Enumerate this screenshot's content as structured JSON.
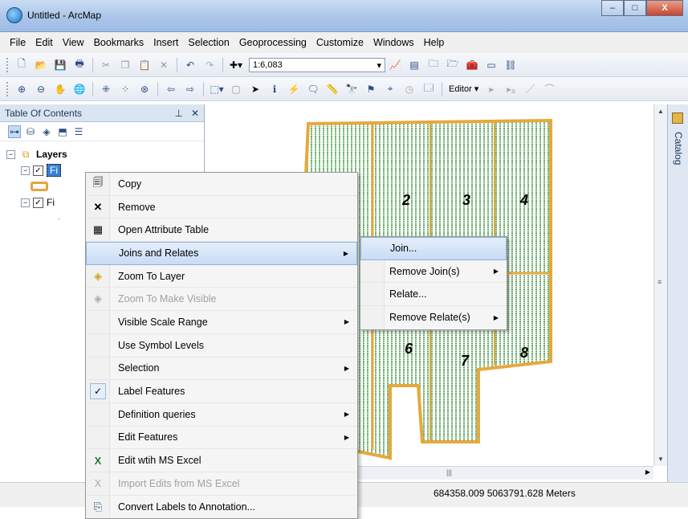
{
  "window": {
    "title": "Untitled - ArcMap",
    "minimize": "–",
    "maximize": "□",
    "close": "X"
  },
  "menubar": [
    "File",
    "Edit",
    "View",
    "Bookmarks",
    "Insert",
    "Selection",
    "Geoprocessing",
    "Customize",
    "Windows",
    "Help"
  ],
  "toolbar": {
    "scale_value": "1:6,083",
    "editor_label": "Editor ▾"
  },
  "toc": {
    "title": "Table Of Contents",
    "pin": "⊥",
    "close": "✕",
    "root_label": "Layers",
    "layer1_label": "Fi",
    "layer2_label": "Fi"
  },
  "map": {
    "field_labels": [
      "2",
      "3",
      "4",
      "6",
      "7",
      "8"
    ],
    "boundary_color": "#e6a93c",
    "rows_color": "#2b8a2b"
  },
  "catalog_label": "Catalog",
  "status": {
    "coordinates": "684358.009  5063791.628 Meters"
  },
  "context_menu": {
    "items": [
      {
        "label": "Copy",
        "icon": "copy-icon",
        "enabled": true
      },
      {
        "label": "Remove",
        "icon": "remove-icon",
        "enabled": true
      },
      {
        "label": "Open Attribute Table",
        "icon": "table-icon",
        "enabled": true
      },
      {
        "label": "Joins and Relates",
        "icon": "",
        "enabled": true,
        "submenu": true
      },
      {
        "label": "Zoom To Layer",
        "icon": "zoom-layer-icon",
        "enabled": true
      },
      {
        "label": "Zoom To Make Visible",
        "icon": "zoom-visible-icon",
        "enabled": false
      },
      {
        "label": "Visible Scale Range",
        "icon": "",
        "enabled": true,
        "submenu": true
      },
      {
        "label": "Use Symbol Levels",
        "icon": "",
        "enabled": true
      },
      {
        "label": "Selection",
        "icon": "",
        "enabled": true,
        "submenu": true
      },
      {
        "label": "Label Features",
        "icon": "check-icon",
        "enabled": true,
        "checked": true
      },
      {
        "label": "Definition queries",
        "icon": "",
        "enabled": true,
        "submenu": true
      },
      {
        "label": "Edit Features",
        "icon": "",
        "enabled": true,
        "submenu": true
      },
      {
        "label": "Edit wtih MS Excel",
        "icon": "excel-icon",
        "enabled": true
      },
      {
        "label": "Import Edits from MS Excel",
        "icon": "excel-import-icon",
        "enabled": false
      },
      {
        "label": "Convert Labels to Annotation...",
        "icon": "annotation-icon",
        "enabled": true
      }
    ]
  },
  "submenu": {
    "items": [
      {
        "label": "Join...",
        "submenu": false
      },
      {
        "label": "Remove Join(s)",
        "submenu": true
      },
      {
        "label": "Relate...",
        "submenu": false
      },
      {
        "label": "Remove Relate(s)",
        "submenu": true
      }
    ]
  }
}
